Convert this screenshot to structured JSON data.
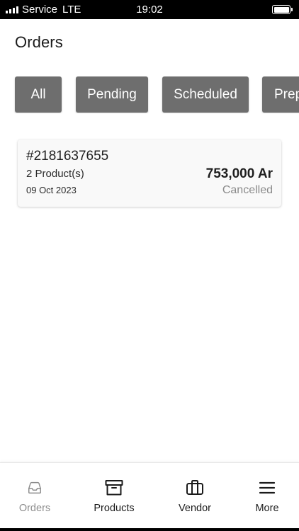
{
  "status_bar": {
    "carrier": "Service",
    "network": "LTE",
    "time": "19:02",
    "battery_level": 1.0
  },
  "header": {
    "title": "Orders"
  },
  "filters": {
    "items": [
      {
        "label": "All"
      },
      {
        "label": "Pending"
      },
      {
        "label": "Scheduled"
      },
      {
        "label": "Prep"
      }
    ]
  },
  "orders": [
    {
      "id": "#2181637655",
      "product_count": "2 Product(s)",
      "date": "09 Oct 2023",
      "amount": "753,000 Ar",
      "status": "Cancelled"
    }
  ],
  "bottom_nav": {
    "items": [
      {
        "label": "Orders",
        "icon": "inbox-icon",
        "active": true
      },
      {
        "label": "Products",
        "icon": "archive-box-icon",
        "active": false
      },
      {
        "label": "Vendor",
        "icon": "briefcase-icon",
        "active": false
      },
      {
        "label": "More",
        "icon": "menu-icon",
        "active": false
      }
    ]
  },
  "colors": {
    "chip_background": "#6e6e6e",
    "inactive_label": "#8d8d8d",
    "status_cancelled": "#8a8a8a"
  }
}
